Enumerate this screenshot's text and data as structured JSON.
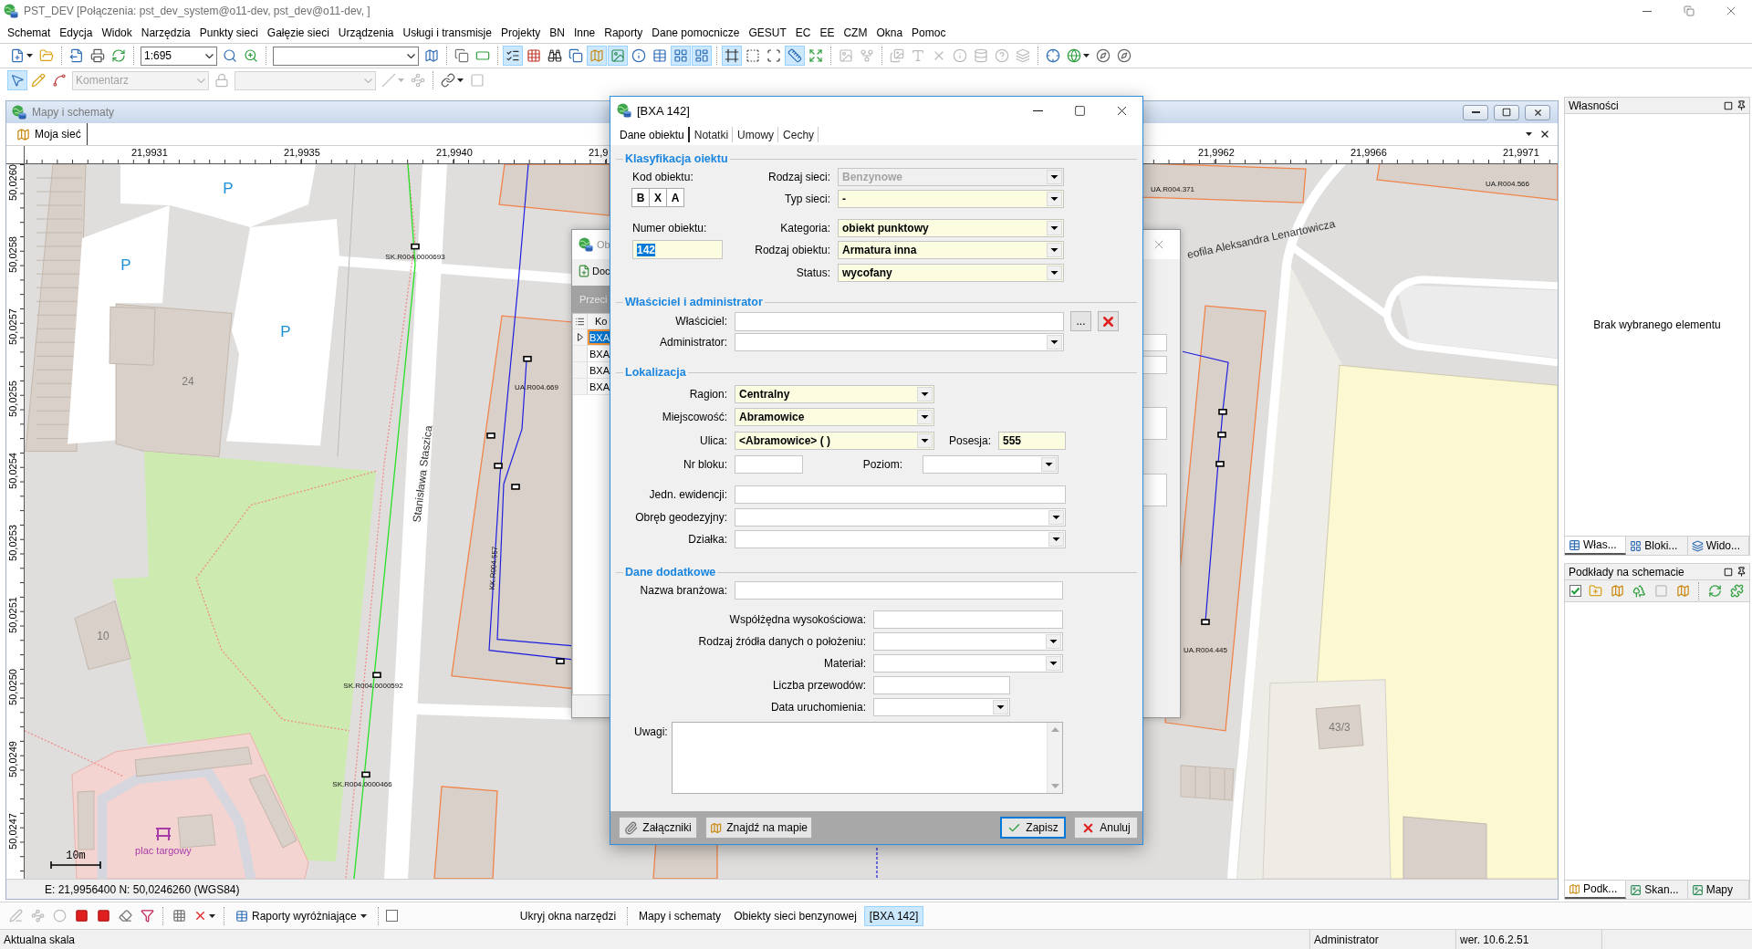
{
  "window": {
    "title": "PST_DEV [Połączenia: pst_dev_system@o11-dev, pst_dev@o11-dev, ]"
  },
  "menu": [
    "Schemat",
    "Edycja",
    "Widok",
    "Narzędzia",
    "Punkty sieci",
    "Gałęzie sieci",
    "Urządzenia",
    "Usługi i transmisje",
    "Projekty",
    "BN",
    "Inne",
    "Raporty",
    "Dane pomocnicze",
    "GESUT",
    "EC",
    "EE",
    "CZM",
    "Okna",
    "Pomoc"
  ],
  "toolbar_main": [
    {
      "kind": "dropdown",
      "pressed": false,
      "disabled": false
    },
    {
      "kind": "button",
      "pressed": false,
      "disabled": false
    },
    {
      "kind": "separator"
    },
    {
      "kind": "button",
      "pressed": false,
      "disabled": false
    },
    {
      "kind": "button",
      "pressed": false,
      "disabled": false
    },
    {
      "kind": "button",
      "pressed": false,
      "disabled": false
    },
    {
      "kind": "separator"
    },
    {
      "kind": "combo",
      "value": "1:695",
      "disabled": false
    },
    {
      "kind": "button",
      "pressed": false,
      "disabled": false
    },
    {
      "kind": "button",
      "pressed": false,
      "disabled": false
    },
    {
      "kind": "separator"
    },
    {
      "kind": "combo",
      "disabled": false
    },
    {
      "kind": "button",
      "pressed": false,
      "disabled": false
    },
    {
      "kind": "separator"
    },
    {
      "kind": "button",
      "pressed": false,
      "disabled": false
    },
    {
      "kind": "button",
      "pressed": false,
      "disabled": false
    },
    {
      "kind": "separator"
    },
    {
      "kind": "button",
      "pressed": true,
      "disabled": false
    },
    {
      "kind": "button",
      "pressed": false,
      "disabled": false
    },
    {
      "kind": "button",
      "pressed": false,
      "disabled": false
    },
    {
      "kind": "button",
      "pressed": false,
      "disabled": false
    },
    {
      "kind": "button",
      "pressed": true,
      "disabled": false
    },
    {
      "kind": "button",
      "pressed": true,
      "disabled": false
    },
    {
      "kind": "button",
      "pressed": false,
      "disabled": false
    },
    {
      "kind": "button",
      "pressed": false,
      "disabled": false
    },
    {
      "kind": "button",
      "pressed": true,
      "disabled": false
    },
    {
      "kind": "button",
      "pressed": true,
      "disabled": false
    },
    {
      "kind": "separator"
    },
    {
      "kind": "button",
      "pressed": true,
      "disabled": false
    },
    {
      "kind": "button",
      "pressed": false,
      "disabled": false
    },
    {
      "kind": "button",
      "pressed": false,
      "disabled": false
    },
    {
      "kind": "button",
      "pressed": true,
      "disabled": false
    },
    {
      "kind": "button",
      "pressed": false,
      "disabled": false
    },
    {
      "kind": "separator"
    },
    {
      "kind": "button",
      "pressed": false,
      "disabled": true
    },
    {
      "kind": "button",
      "pressed": false,
      "disabled": true
    },
    {
      "kind": "separator"
    },
    {
      "kind": "button",
      "pressed": false,
      "disabled": true
    },
    {
      "kind": "button",
      "pressed": false,
      "disabled": true
    },
    {
      "kind": "button",
      "pressed": false,
      "disabled": true
    },
    {
      "kind": "button",
      "pressed": false,
      "disabled": true
    },
    {
      "kind": "button",
      "pressed": false,
      "disabled": true
    },
    {
      "kind": "button",
      "pressed": false,
      "disabled": true
    },
    {
      "kind": "button",
      "pressed": false,
      "disabled": true
    },
    {
      "kind": "separator"
    },
    {
      "kind": "button",
      "pressed": false,
      "disabled": false
    },
    {
      "kind": "dropdown",
      "pressed": false,
      "disabled": false
    },
    {
      "kind": "button",
      "pressed": false,
      "disabled": false
    },
    {
      "kind": "button",
      "pressed": false,
      "disabled": false
    }
  ],
  "toolbar_edit": [
    {
      "kind": "button",
      "pressed": true,
      "disabled": false
    },
    {
      "kind": "button",
      "pressed": false,
      "disabled": false
    },
    {
      "kind": "button",
      "pressed": false,
      "disabled": false
    },
    {
      "kind": "combo",
      "value": "Komentarz",
      "disabled": true
    },
    {
      "kind": "button",
      "pressed": false,
      "disabled": true
    },
    {
      "kind": "combo",
      "disabled": true
    },
    {
      "kind": "dropdown",
      "pressed": false,
      "disabled": true
    },
    {
      "kind": "button",
      "pressed": false,
      "disabled": true
    },
    {
      "kind": "separator"
    },
    {
      "kind": "dropdown",
      "pressed": false,
      "disabled": false
    },
    {
      "kind": "button",
      "pressed": false,
      "disabled": true
    }
  ],
  "map_window": {
    "title": "Mapy i schematy",
    "tabs": [
      {
        "label": "Moja sieć",
        "selected": true
      }
    ],
    "x_ticks": [
      "21,9931",
      "21,9935",
      "21,9940",
      "21,9",
      "21,9962",
      "21,9966",
      "21,9971"
    ],
    "y_ticks": [
      "50,0260",
      "50,0258",
      "50,0257",
      "50,0255",
      "50,0254",
      "50,0253",
      "50,0251",
      "50,0250",
      "50,0249",
      "50,0247"
    ],
    "labels": [
      {
        "kind": "parking",
        "text": "P"
      },
      {
        "kind": "parking",
        "text": "P"
      },
      {
        "kind": "parking",
        "text": "P"
      },
      {
        "kind": "house",
        "text": "24"
      },
      {
        "kind": "object",
        "text": "SK.R004.0000693"
      },
      {
        "kind": "street",
        "text": "Stanisława Staszica"
      },
      {
        "kind": "object",
        "text": "UA.R004.669"
      },
      {
        "kind": "object",
        "text": "KK.R004.557"
      },
      {
        "kind": "house",
        "text": "10"
      },
      {
        "kind": "object",
        "text": "SK.R004.0000592"
      },
      {
        "kind": "object",
        "text": "SK.R004.0000466"
      },
      {
        "kind": "place",
        "text": "plac targowy"
      },
      {
        "kind": "object",
        "text": "UA.R004.371"
      },
      {
        "kind": "object",
        "text": "UA.R004.566"
      },
      {
        "kind": "street",
        "text": "eofila Aleksandra Lenartowicza"
      },
      {
        "kind": "object",
        "text": "UA.R004.445"
      },
      {
        "kind": "house",
        "text": "43/3"
      }
    ],
    "scale": "10m",
    "coordinates": "E: 21,9956400 N: 50,0246260 (WGS84)"
  },
  "objects_window": {
    "title": "Ob",
    "toolbar_button": "Doc",
    "header": "Przeci",
    "column": "Ko",
    "rows": [
      {
        "code": "BXA",
        "selected": true
      },
      {
        "code": "BXA",
        "selected": false
      },
      {
        "code": "BXA",
        "selected": false
      },
      {
        "code": "BXA",
        "selected": false
      }
    ]
  },
  "dialog": {
    "title": "[BXA 142]",
    "tabs": [
      {
        "label": "Dane obiektu",
        "selected": true
      },
      {
        "label": "Notatki",
        "selected": false
      },
      {
        "label": "Umowy",
        "selected": false
      },
      {
        "label": "Cechy",
        "selected": false
      }
    ],
    "classification": {
      "heading": "Klasyfikacja oiektu",
      "code_label": "Kod obiektu:",
      "code": [
        "B",
        "X",
        "A"
      ],
      "number": {
        "label": "Numer obiektu:",
        "value": "142",
        "required": true
      },
      "fields": [
        {
          "label": "Rodzaj sieci:",
          "value": "Benzynowe",
          "disabled": true,
          "required": false
        },
        {
          "label": "Typ sieci:",
          "value": "-",
          "disabled": false,
          "required": true
        },
        {
          "label": "Kategoria:",
          "value": "obiekt punktowy",
          "disabled": false,
          "required": true
        },
        {
          "label": "Rodzaj obiektu:",
          "value": "Armatura inna",
          "disabled": false,
          "required": true
        },
        {
          "label": "Status:",
          "value": "wycofany",
          "disabled": false,
          "required": true
        }
      ]
    },
    "owner": {
      "heading": "Właściciel i administrator",
      "owner": {
        "label": "Właściciel:",
        "required": false,
        "browse": "..."
      },
      "administrator": {
        "label": "Administrator:",
        "required": false
      }
    },
    "location": {
      "heading": "Lokalizacja",
      "address": [
        {
          "label": "Ragion:",
          "value": "Centralny",
          "required": true
        },
        {
          "label": "Miejscowość:",
          "value": "Abramowice",
          "required": true
        },
        {
          "label": "Ulica:",
          "value": "<Abramowice> ( )",
          "required": true
        }
      ],
      "house": {
        "label": "Posesja:",
        "value": "555",
        "required": true
      },
      "block": {
        "label": "Nr bloku:",
        "required": false
      },
      "floor": {
        "label": "Poziom:",
        "required": false
      },
      "registry": [
        {
          "label": "Jedn. ewidencji:",
          "kind": "text",
          "required": false
        },
        {
          "label": "Obręb geodezyjny:",
          "kind": "combo",
          "required": false
        },
        {
          "label": "Działka:",
          "kind": "combo",
          "required": false
        }
      ]
    },
    "additional": {
      "heading": "Dane dodatkowe",
      "trade_name": {
        "label": "Nazwa branżowa:",
        "required": false
      },
      "fields": [
        {
          "label": "Współżędna wysokościowa:",
          "kind": "text",
          "required": false
        },
        {
          "label": "Rodzaj źródła danych o położeniu:",
          "kind": "combo",
          "required": false
        },
        {
          "label": "Materiał:",
          "kind": "combo",
          "required": false
        },
        {
          "label": "Liczba przewodów:",
          "kind": "number",
          "required": false
        },
        {
          "label": "Data uruchomienia:",
          "kind": "date",
          "required": false
        }
      ],
      "notes": {
        "label": "Uwagi:"
      }
    },
    "buttons": [
      {
        "label": "Załączniki",
        "kind": "attach",
        "default": false
      },
      {
        "label": "Znajdź na mapie",
        "kind": "locate",
        "default": false
      },
      {
        "label": "Zapisz",
        "kind": "save",
        "default": true
      },
      {
        "label": "Anuluj",
        "kind": "cancel",
        "default": false
      }
    ]
  },
  "properties_panel": {
    "title": "Własności",
    "empty_text": "Brak wybranego elementu",
    "tabs": [
      {
        "label": "Włas...",
        "selected": true
      },
      {
        "label": "Bloki...",
        "selected": false
      },
      {
        "label": "Wido...",
        "selected": false
      }
    ]
  },
  "backgrounds_panel": {
    "title": "Podkłady na schemacie",
    "toolbar": [
      {
        "kind": "checkbox",
        "checked": true
      },
      {
        "kind": "button",
        "disabled": false
      },
      {
        "kind": "button",
        "disabled": false
      },
      {
        "kind": "button",
        "disabled": false
      },
      {
        "kind": "button",
        "disabled": true
      },
      {
        "kind": "button",
        "disabled": false
      },
      {
        "kind": "separator"
      },
      {
        "kind": "button",
        "disabled": false
      },
      {
        "kind": "button",
        "disabled": false
      }
    ],
    "tabs": [
      {
        "label": "Podk...",
        "selected": true
      },
      {
        "label": "Skan...",
        "selected": false
      },
      {
        "label": "Mapy",
        "selected": false
      }
    ]
  },
  "taskbar": {
    "tools": [
      {
        "kind": "button",
        "disabled": true
      },
      {
        "kind": "button",
        "disabled": true
      },
      {
        "kind": "button",
        "disabled": true
      },
      {
        "kind": "button",
        "disabled": false
      },
      {
        "kind": "button",
        "disabled": false
      },
      {
        "kind": "button",
        "disabled": false
      },
      {
        "kind": "button",
        "disabled": false
      },
      {
        "kind": "separator"
      },
      {
        "kind": "button",
        "disabled": false
      },
      {
        "kind": "dropdown",
        "disabled": false
      },
      {
        "kind": "separator"
      }
    ],
    "reports_button": {
      "label": "Raporty wyróżniające"
    },
    "toggle": {
      "checked": false
    },
    "hide_tools": {
      "label": "Ukryj okna narzędzi"
    },
    "windows": [
      {
        "label": "Mapy i schematy",
        "selected": false
      },
      {
        "label": "Obiekty sieci benzynowej",
        "selected": false
      },
      {
        "label": "[BXA 142]",
        "selected": true
      }
    ]
  },
  "status_bar": [
    "Aktualna skala",
    "Administrator",
    "wer. 10.6.2.51"
  ]
}
